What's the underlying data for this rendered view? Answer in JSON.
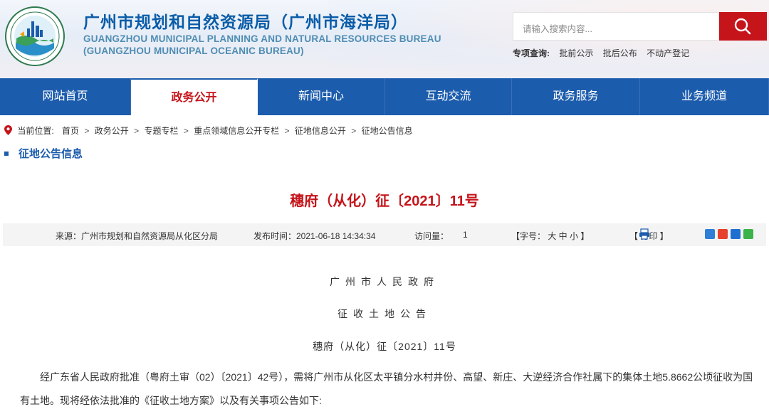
{
  "header": {
    "title": "广州市规划和自然资源局（广州市海洋局）",
    "en_line1": "GUANGZHOU MUNICIPAL PLANNING AND NATURAL RESOURCES BUREAU",
    "en_line2": "(GUANGZHOU MUNICIPAL OCEANIC BUREAU)",
    "logo_icon": "bureau-emblem-icon"
  },
  "search": {
    "placeholder": "请输入搜索内容...",
    "button_icon": "search-icon"
  },
  "quick_links": {
    "label": "专项查询:",
    "items": [
      "批前公示",
      "批后公布",
      "不动产登记"
    ]
  },
  "nav": {
    "items": [
      {
        "label": "网站首页"
      },
      {
        "label": "政务公开"
      },
      {
        "label": "新闻中心"
      },
      {
        "label": "互动交流"
      },
      {
        "label": "政务服务"
      },
      {
        "label": "业务频道"
      }
    ],
    "active_index": 1
  },
  "breadcrumb": {
    "label": "当前位置:",
    "items": [
      "首页",
      "政务公开",
      "专题专栏",
      "重点领域信息公开专栏",
      "征地信息公开",
      "征地公告信息"
    ],
    "separator": ">"
  },
  "section": {
    "title": "征地公告信息"
  },
  "article": {
    "title": "穗府（从化）征〔2021〕11号",
    "meta": {
      "source": "来源：广州市规划和自然资源局从化区分局",
      "publish_time": "发布时间：2021-06-18 14:34:34",
      "visits_label": "访问量：",
      "visits_value": "1",
      "font_size": "【字号： 大  中  小 】",
      "print": "【  打印 】"
    },
    "issuer": "广州市人民政府",
    "notice_title": "征收土地公告",
    "doc_number": "穗府（从化）征〔2021〕11号",
    "paragraph": "经广东省人民政府批准（粤府土审（02）〔2021〕42号），需将广州市从化区太平镇分水村井份、高望、新庄、大逆经济合作社属下的集体土地5.8662公顷征收为国有土地。现将经依法批准的《征收土地方案》以及有关事项公告如下:"
  },
  "colors": {
    "brand_blue": "#1c5cad",
    "accent_red": "#c5141a"
  }
}
